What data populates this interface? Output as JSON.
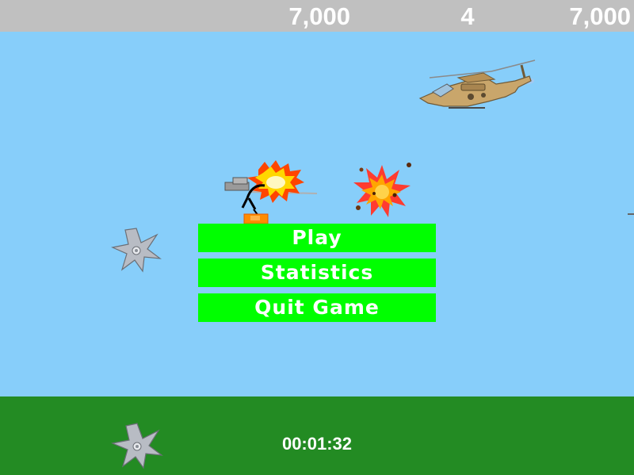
{
  "hud": {
    "score": "7,000",
    "lives": "4",
    "high_score": "7,000",
    "background": "#c0c0c0"
  },
  "menu": {
    "play_label": "Play",
    "statistics_label": "Statistics",
    "quit_label": "Quit Game",
    "button_color": "#00ff00"
  },
  "footer": {
    "timer": "00:01:32"
  },
  "colors": {
    "sky": "#87cefa",
    "ground": "#238b23",
    "text": "#ffffff"
  },
  "sprites": {
    "enemy": "attack-helicopter",
    "hazard": "shuriken-icon",
    "player": "gunner-with-muzzle-flash",
    "effect": "explosion"
  }
}
